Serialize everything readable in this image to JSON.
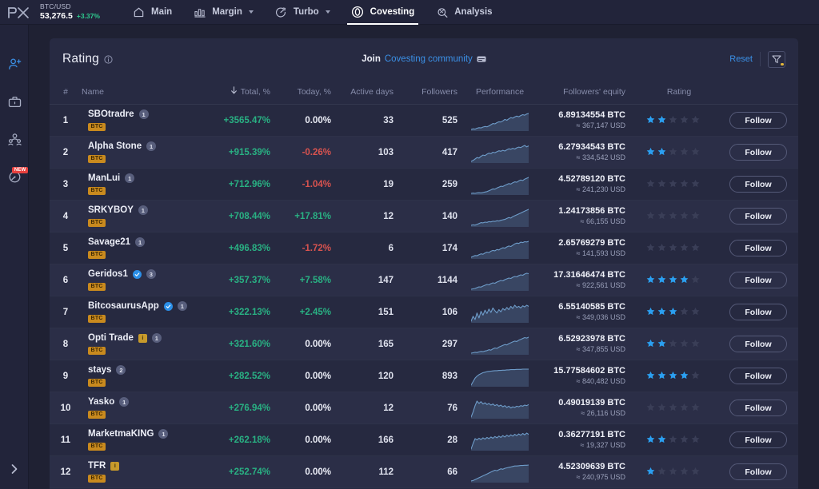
{
  "topbar": {
    "logo": "primexbt-logo",
    "ticker": {
      "pair": "BTC/USD",
      "price": "53,276.5",
      "change": "+3.37%"
    },
    "nav": [
      {
        "id": "main",
        "label": "Main",
        "icon": "home-icon",
        "caret": false,
        "active": false
      },
      {
        "id": "margin",
        "label": "Margin",
        "icon": "bars-icon",
        "caret": true,
        "active": false
      },
      {
        "id": "turbo",
        "label": "Turbo",
        "icon": "turbo-icon",
        "caret": true,
        "active": false
      },
      {
        "id": "covesting",
        "label": "Covesting",
        "icon": "covesting-icon",
        "caret": false,
        "active": true
      },
      {
        "id": "analysis",
        "label": "Analysis",
        "icon": "analysis-icon",
        "caret": false,
        "active": false
      }
    ]
  },
  "rail": {
    "items": [
      {
        "id": "follow",
        "icon": "person-add-icon",
        "badge": "",
        "active": true
      },
      {
        "id": "portfolio",
        "icon": "briefcase-icon",
        "badge": "",
        "active": false
      },
      {
        "id": "community",
        "icon": "people-icon",
        "badge": "",
        "active": false
      },
      {
        "id": "activity",
        "icon": "gauge-icon",
        "badge": "NEW",
        "active": false
      }
    ],
    "expand_icon": "chevron-right-icon"
  },
  "panel": {
    "title": "Rating",
    "info_icon": "info-icon",
    "join_label": "Join",
    "join_link": "Covesting community",
    "telegram_icon": "telegram-icon",
    "reset_label": "Reset",
    "filter_icon": "filter-icon"
  },
  "table": {
    "columns": [
      {
        "key": "rank",
        "label": "#"
      },
      {
        "key": "name",
        "label": "Name"
      },
      {
        "key": "total",
        "label": "Total, %",
        "sorted": true,
        "sort_icon": "sort-desc-arrow-icon"
      },
      {
        "key": "today",
        "label": "Today, %"
      },
      {
        "key": "days",
        "label": "Active days"
      },
      {
        "key": "followers",
        "label": "Followers"
      },
      {
        "key": "perf",
        "label": "Performance"
      },
      {
        "key": "equity",
        "label": "Followers' equity"
      },
      {
        "key": "rating",
        "label": "Rating"
      },
      {
        "key": "action",
        "label": ""
      }
    ],
    "follow_label": "Follow",
    "asset_tag": "BTC",
    "rows": [
      {
        "rank": "1",
        "name": "SBOtradre",
        "verified": false,
        "gold": false,
        "count": "1",
        "total": "+3565.47%",
        "today": "0.00%",
        "today_state": "zero",
        "days": "33",
        "followers": "525",
        "equity_btc": "6.89134554 BTC",
        "equity_usd": "≈ 367,147 USD",
        "stars": 2,
        "spark": [
          18,
          20,
          19,
          22,
          24,
          23,
          26,
          28,
          27,
          30,
          34,
          38,
          37,
          41,
          44,
          43,
          47,
          52,
          49,
          54,
          58,
          56,
          60,
          63,
          61,
          65,
          68,
          66,
          70,
          72
        ]
      },
      {
        "rank": "2",
        "name": "Alpha Stone",
        "verified": false,
        "gold": false,
        "count": "1",
        "total": "+915.39%",
        "today": "-0.26%",
        "today_state": "neg",
        "days": "103",
        "followers": "417",
        "equity_btc": "6.27934543 BTC",
        "equity_usd": "≈ 334,542 USD",
        "stars": 2,
        "spark": [
          12,
          16,
          22,
          28,
          26,
          33,
          38,
          36,
          42,
          46,
          44,
          50,
          48,
          52,
          56,
          54,
          58,
          55,
          60,
          64,
          62,
          66,
          63,
          68,
          71,
          69,
          74,
          78,
          72,
          76
        ]
      },
      {
        "rank": "3",
        "name": "ManLui",
        "verified": false,
        "gold": false,
        "count": "1",
        "total": "+712.96%",
        "today": "-1.04%",
        "today_state": "neg",
        "days": "19",
        "followers": "259",
        "equity_btc": "4.52789120 BTC",
        "equity_usd": "≈ 241,230 USD",
        "stars": 0,
        "spark": [
          10,
          11,
          10,
          12,
          13,
          12,
          14,
          16,
          18,
          22,
          26,
          30,
          29,
          34,
          38,
          42,
          41,
          46,
          50,
          54,
          52,
          58,
          62,
          60,
          66,
          70,
          68,
          74,
          78,
          82
        ]
      },
      {
        "rank": "4",
        "name": "SRKYBOY",
        "verified": false,
        "gold": false,
        "count": "1",
        "total": "+708.44%",
        "today": "+17.81%",
        "today_state": "pos",
        "days": "12",
        "followers": "140",
        "equity_btc": "1.24173856 BTC",
        "equity_usd": "≈ 66,155 USD",
        "stars": 0,
        "spark": [
          14,
          16,
          15,
          18,
          22,
          26,
          25,
          28,
          27,
          30,
          29,
          32,
          31,
          34,
          33,
          36,
          38,
          40,
          44,
          48,
          46,
          52,
          56,
          60,
          64,
          68,
          72,
          76,
          80,
          84
        ]
      },
      {
        "rank": "5",
        "name": "Savage21",
        "verified": false,
        "gold": false,
        "count": "1",
        "total": "+496.83%",
        "today": "-1.72%",
        "today_state": "neg",
        "days": "6",
        "followers": "174",
        "equity_btc": "2.65769279 BTC",
        "equity_usd": "≈ 141,593 USD",
        "stars": 0,
        "spark": [
          8,
          12,
          16,
          15,
          20,
          24,
          22,
          28,
          32,
          30,
          36,
          40,
          38,
          44,
          42,
          48,
          52,
          50,
          56,
          60,
          58,
          64,
          70,
          74,
          72,
          78,
          76,
          80,
          79,
          82
        ]
      },
      {
        "rank": "6",
        "name": "Geridos1",
        "verified": true,
        "gold": false,
        "count": "3",
        "total": "+357.37%",
        "today": "+7.58%",
        "today_state": "pos",
        "days": "147",
        "followers": "1144",
        "equity_btc": "17.31646474 BTC",
        "equity_usd": "≈ 922,561 USD",
        "stars": 4,
        "spark": [
          6,
          8,
          10,
          14,
          18,
          17,
          22,
          26,
          30,
          28,
          34,
          38,
          36,
          42,
          46,
          50,
          48,
          54,
          58,
          62,
          60,
          66,
          70,
          68,
          74,
          78,
          76,
          82,
          86,
          84
        ]
      },
      {
        "rank": "7",
        "name": "BitcosaurusApp",
        "verified": true,
        "gold": false,
        "count": "1",
        "total": "+322.13%",
        "today": "+2.45%",
        "today_state": "pos",
        "days": "151",
        "followers": "106",
        "equity_btc": "6.55140585 BTC",
        "equity_usd": "≈ 349,036 USD",
        "stars": 3,
        "spark": [
          30,
          48,
          36,
          60,
          42,
          66,
          52,
          70,
          58,
          74,
          62,
          78,
          68,
          60,
          72,
          64,
          76,
          70,
          80,
          72,
          84,
          76,
          88,
          80,
          84,
          78,
          86,
          82,
          88,
          84
        ]
      },
      {
        "rank": "8",
        "name": "Opti Trade",
        "verified": false,
        "gold": true,
        "count": "1",
        "total": "+321.60%",
        "today": "0.00%",
        "today_state": "zero",
        "days": "165",
        "followers": "297",
        "equity_btc": "6.52923978 BTC",
        "equity_usd": "≈ 347,855 USD",
        "stars": 2,
        "spark": [
          10,
          12,
          14,
          13,
          16,
          18,
          17,
          20,
          22,
          26,
          24,
          30,
          34,
          32,
          38,
          42,
          46,
          50,
          48,
          54,
          58,
          62,
          66,
          64,
          70,
          74,
          78,
          82,
          80,
          84
        ]
      },
      {
        "rank": "9",
        "name": "stays",
        "verified": false,
        "gold": false,
        "count": "2",
        "total": "+282.52%",
        "today": "0.00%",
        "today_state": "zero",
        "days": "120",
        "followers": "893",
        "equity_btc": "15.77584602 BTC",
        "equity_usd": "≈ 840,482 USD",
        "stars": 4,
        "spark": [
          20,
          34,
          48,
          56,
          62,
          66,
          70,
          72,
          74,
          75,
          76,
          77,
          78,
          78,
          79,
          79,
          80,
          80,
          81,
          81,
          82,
          82,
          82,
          83,
          83,
          83,
          84,
          84,
          84,
          84
        ]
      },
      {
        "rank": "10",
        "name": "Yasko",
        "verified": false,
        "gold": false,
        "count": "1",
        "total": "+276.94%",
        "today": "0.00%",
        "today_state": "zero",
        "days": "12",
        "followers": "76",
        "equity_btc": "0.49019139 BTC",
        "equity_usd": "≈ 26,116 USD",
        "stars": 0,
        "spark": [
          12,
          30,
          52,
          68,
          60,
          66,
          58,
          62,
          56,
          60,
          54,
          58,
          52,
          56,
          50,
          54,
          48,
          52,
          46,
          50,
          44,
          48,
          46,
          50,
          48,
          52,
          50,
          54,
          52,
          56
        ]
      },
      {
        "rank": "11",
        "name": "MarketmaKING",
        "verified": false,
        "gold": false,
        "count": "1",
        "total": "+262.18%",
        "today": "0.00%",
        "today_state": "zero",
        "days": "166",
        "followers": "28",
        "equity_btc": "0.36277191 BTC",
        "equity_usd": "≈ 19,327 USD",
        "stars": 2,
        "spark": [
          14,
          40,
          62,
          56,
          64,
          58,
          66,
          60,
          68,
          62,
          70,
          64,
          72,
          66,
          74,
          68,
          76,
          70,
          78,
          72,
          80,
          74,
          82,
          76,
          84,
          78,
          86,
          80,
          88,
          82
        ]
      },
      {
        "rank": "12",
        "name": "TFR",
        "verified": false,
        "gold": true,
        "count": "",
        "total": "+252.74%",
        "today": "0.00%",
        "today_state": "zero",
        "days": "112",
        "followers": "66",
        "equity_btc": "4.52309639 BTC",
        "equity_usd": "≈ 240,975 USD",
        "stars": 1,
        "spark": [
          16,
          18,
          22,
          26,
          30,
          34,
          38,
          42,
          46,
          50,
          54,
          58,
          62,
          60,
          64,
          68,
          66,
          70,
          72,
          74,
          76,
          78,
          80,
          80,
          81,
          82,
          82,
          83,
          83,
          84
        ]
      }
    ]
  },
  "colors": {
    "positive": "#29b183",
    "negative": "#d9534f",
    "accent": "#3b90e6",
    "star": "#2b9ff0",
    "star_off": "#3a3e57",
    "tag": "#c98a1e"
  }
}
